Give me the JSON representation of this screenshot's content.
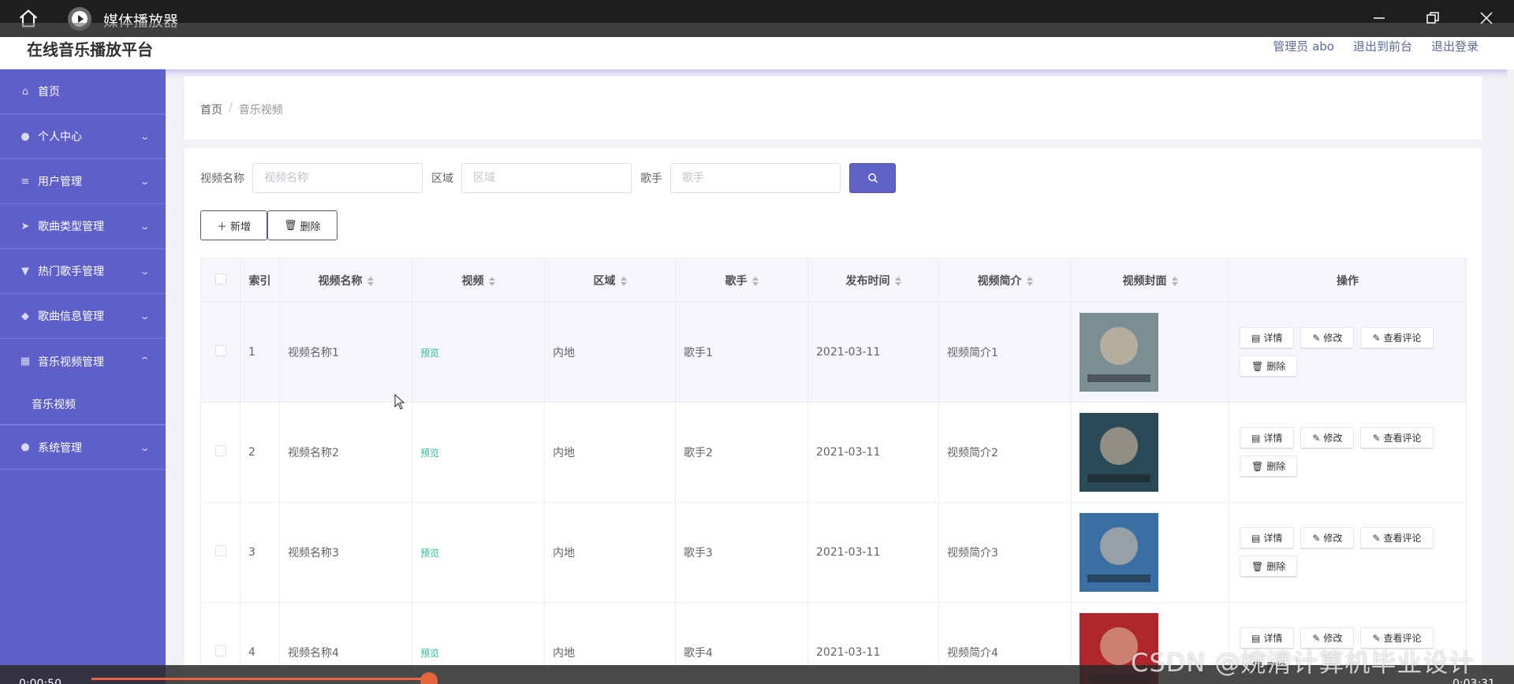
{
  "player": {
    "title": "媒体播放器",
    "time_elapsed": "0:00:50",
    "time_total": "0:03:31",
    "progress": 0.24
  },
  "header": {
    "brand": "在线音乐播放平台",
    "admin": "管理员 abo",
    "to_front": "退出到前台",
    "logout": "退出登录"
  },
  "sidebar": {
    "items": [
      {
        "label": "首页",
        "icon": "home-icon"
      },
      {
        "label": "个人中心",
        "icon": "user-icon"
      },
      {
        "label": "用户管理",
        "icon": "menu-icon"
      },
      {
        "label": "歌曲类型管理",
        "icon": "send-icon"
      },
      {
        "label": "热门歌手管理",
        "icon": "badge-icon"
      },
      {
        "label": "歌曲信息管理",
        "icon": "controller-icon"
      },
      {
        "label": "音乐视频管理",
        "icon": "grid-icon"
      },
      {
        "label": "音乐视频",
        "icon": ""
      },
      {
        "label": "系统管理",
        "icon": "user-icon"
      }
    ]
  },
  "breadcrumb": {
    "home": "首页",
    "current": "音乐视频"
  },
  "search": {
    "name_label": "视频名称",
    "name_placeholder": "视频名称",
    "region_label": "区域",
    "region_placeholder": "区域",
    "singer_label": "歌手",
    "singer_placeholder": "歌手"
  },
  "toolbar": {
    "add_label": "新增",
    "delete_label": "删除"
  },
  "table": {
    "headers": [
      "索引",
      "视频名称",
      "视频",
      "区域",
      "歌手",
      "发布时间",
      "视频简介",
      "视频封面",
      "操作"
    ],
    "preview_label": "预览",
    "ops": {
      "detail": "详情",
      "edit": "修改",
      "comments": "查看评论",
      "delete": "删除"
    },
    "rows": [
      {
        "index": "1",
        "name": "视频名称1",
        "region": "内地",
        "singer": "歌手1",
        "date": "2021-03-11",
        "intro": "视频简介1",
        "cover_color": "#7b8e93"
      },
      {
        "index": "2",
        "name": "视频名称2",
        "region": "内地",
        "singer": "歌手2",
        "date": "2021-03-11",
        "intro": "视频简介2",
        "cover_color": "#2b4a57"
      },
      {
        "index": "3",
        "name": "视频名称3",
        "region": "内地",
        "singer": "歌手3",
        "date": "2021-03-11",
        "intro": "视频简介3",
        "cover_color": "#3a6fa3"
      },
      {
        "index": "4",
        "name": "视频名称4",
        "region": "内地",
        "singer": "歌手4",
        "date": "2021-03-11",
        "intro": "视频简介4",
        "cover_color": "#b0262d"
      }
    ]
  },
  "watermark": "CSDN @婉清计算机毕业设计",
  "colors": {
    "sidebar": "#5e5fc9",
    "accent": "#5f61c7",
    "preview": "#2dbd9c",
    "progress": "#e8663c"
  }
}
